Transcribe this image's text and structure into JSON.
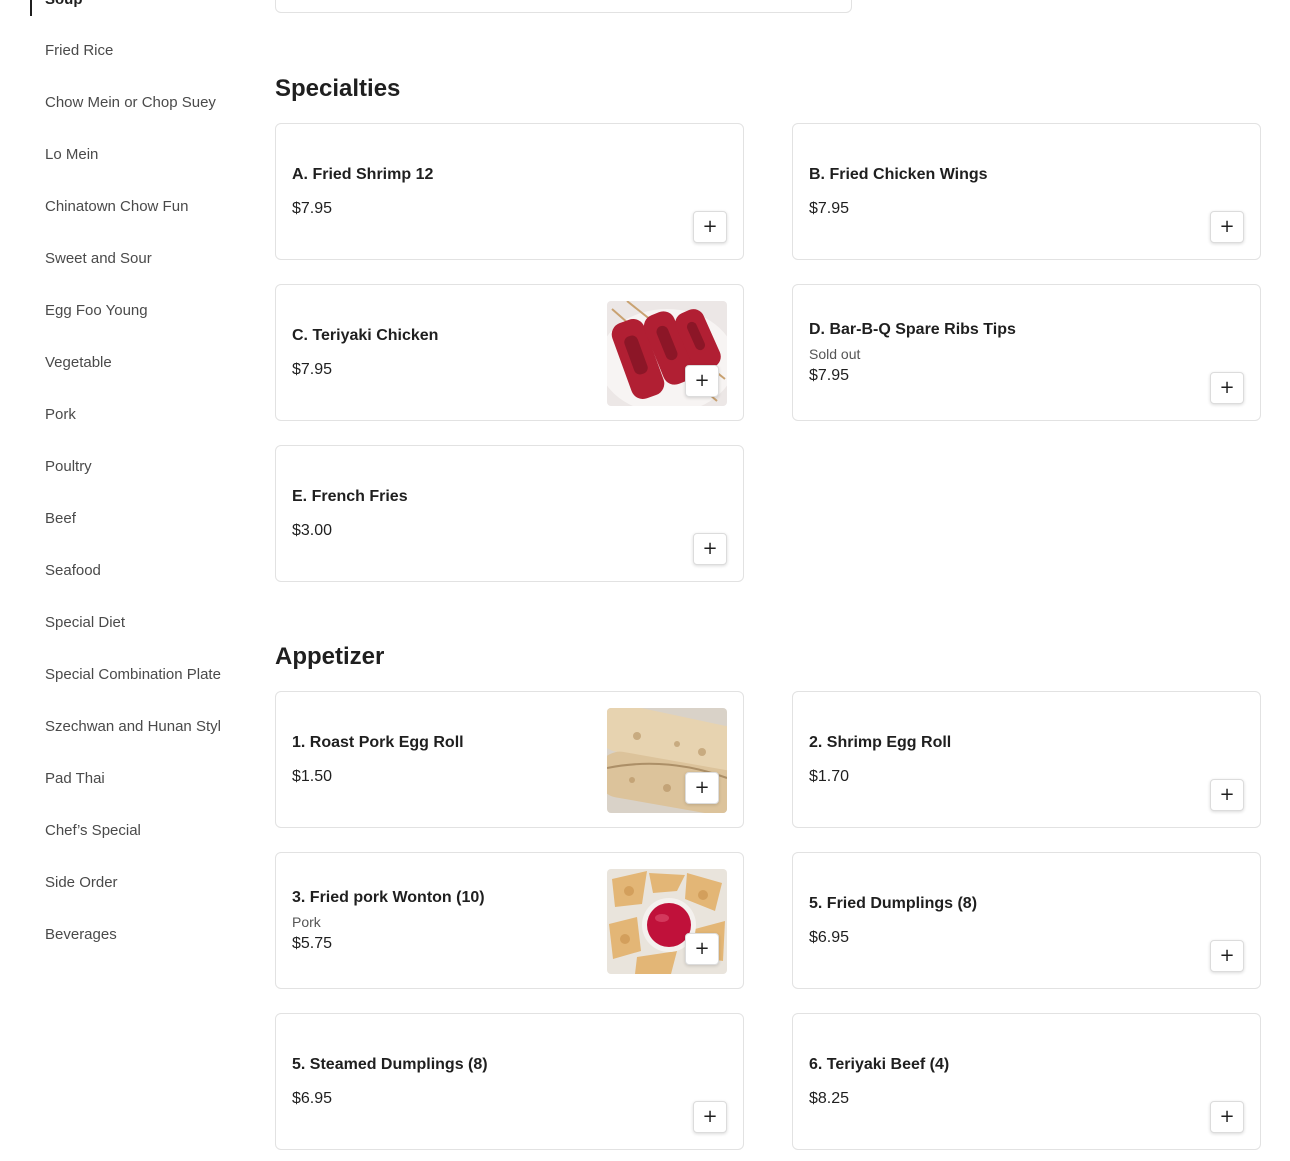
{
  "sidebar": {
    "active_item": "Soup",
    "items": [
      "Fried Rice",
      "Chow Mein or Chop Suey",
      "Lo Mein",
      "Chinatown Chow Fun",
      "Sweet and Sour",
      "Egg Foo Young",
      "Vegetable",
      "Pork",
      "Poultry",
      "Beef",
      "Seafood",
      "Special Diet",
      "Special Combination Plate",
      "Szechwan and Hunan Styl",
      "Pad Thai",
      "Chef’s Special",
      "Side Order",
      "Beverages"
    ]
  },
  "sections": {
    "specialties": {
      "title": "Specialties",
      "items": [
        {
          "name": "A. Fried Shrimp 12",
          "price": "$7.95"
        },
        {
          "name": "B. Fried Chicken Wings",
          "price": "$7.95"
        },
        {
          "name": "C. Teriyaki Chicken",
          "price": "$7.95",
          "image": "teriyaki-chicken-photo"
        },
        {
          "name": "D. Bar-B-Q Spare Ribs Tips",
          "note": "Sold out",
          "price": "$7.95"
        },
        {
          "name": "E. French Fries",
          "price": "$3.00"
        }
      ]
    },
    "appetizer": {
      "title": "Appetizer",
      "items": [
        {
          "name": "1. Roast Pork Egg Roll",
          "price": "$1.50",
          "image": "egg-roll-photo"
        },
        {
          "name": "2. Shrimp Egg Roll",
          "price": "$1.70"
        },
        {
          "name": "3. Fried pork Wonton (10)",
          "note": "Pork",
          "price": "$5.75",
          "image": "wonton-photo"
        },
        {
          "name": "5. Fried Dumplings (8)",
          "price": "$6.95"
        },
        {
          "name": "5. Steamed Dumplings (8)",
          "price": "$6.95"
        },
        {
          "name": "6. Teriyaki Beef (4)",
          "price": "$8.25"
        }
      ]
    }
  },
  "icons": {
    "add": "+"
  },
  "colors": {
    "text": "#1f1f1f",
    "muted": "#4a4a4a",
    "border": "#e2e2e2"
  }
}
